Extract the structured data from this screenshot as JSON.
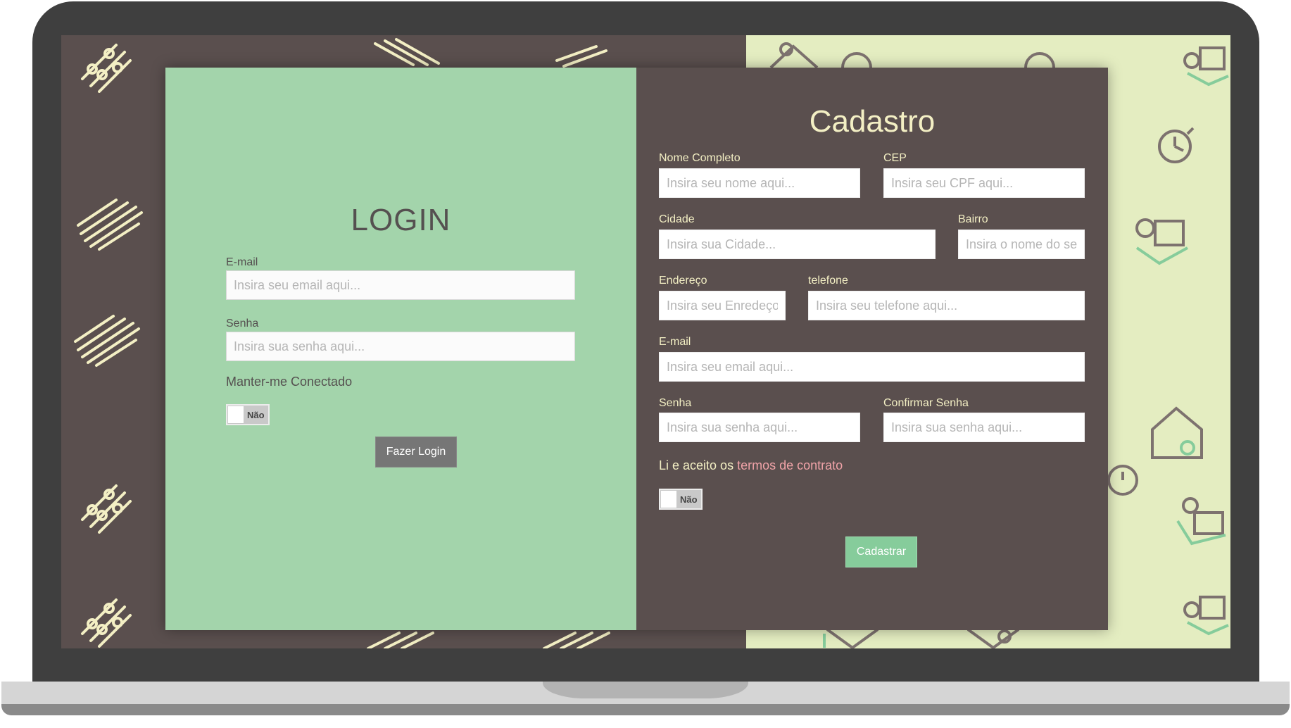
{
  "login": {
    "title": "LOGIN",
    "email_label": "E-mail",
    "email_placeholder": "Insira seu email aqui...",
    "password_label": "Senha",
    "password_placeholder": "Insira sua senha aqui...",
    "remember_label": "Manter-me Conectado",
    "remember_toggle_text": "Não",
    "submit_label": "Fazer Login"
  },
  "register": {
    "title": "Cadastro",
    "name_label": "Nome Completo",
    "name_placeholder": "Insira seu nome aqui...",
    "cep_label": "CEP",
    "cep_placeholder": "Insira seu CPF aqui...",
    "city_label": "Cidade",
    "city_placeholder": "Insira sua Cidade...",
    "district_label": "Bairro",
    "district_placeholder": "Insira o nome do seu bairro...",
    "address_label": "Endereço",
    "address_placeholder": "Insira seu Enredeço",
    "phone_label": "telefone",
    "phone_placeholder": "Insira seu telefone aqui...",
    "email_label": "E-mail",
    "email_placeholder": "Insira seu email aqui...",
    "password_label": "Senha",
    "password_placeholder": "Insira sua senha aqui...",
    "confirm_label": "Confirmar Senha",
    "confirm_placeholder": "Insira sua senha aqui...",
    "terms_prefix": "Li e aceito os ",
    "terms_link": "termos de contrato",
    "terms_toggle_text": "Não",
    "submit_label": "Cadastrar"
  },
  "colors": {
    "login_panel": "#a3d4ab",
    "register_panel": "#5a4f4e",
    "accent_cream": "#f3efc4",
    "terms_link": "#f0a3a8",
    "register_button": "#86cc9b",
    "login_button": "#767676",
    "pattern_right_bg": "#e4edc1"
  },
  "icons": {
    "left_pattern": [
      "slider-icon",
      "stripes-icon"
    ],
    "right_pattern": [
      "delivery-person-icon",
      "stopwatch-icon",
      "house-icon"
    ]
  }
}
